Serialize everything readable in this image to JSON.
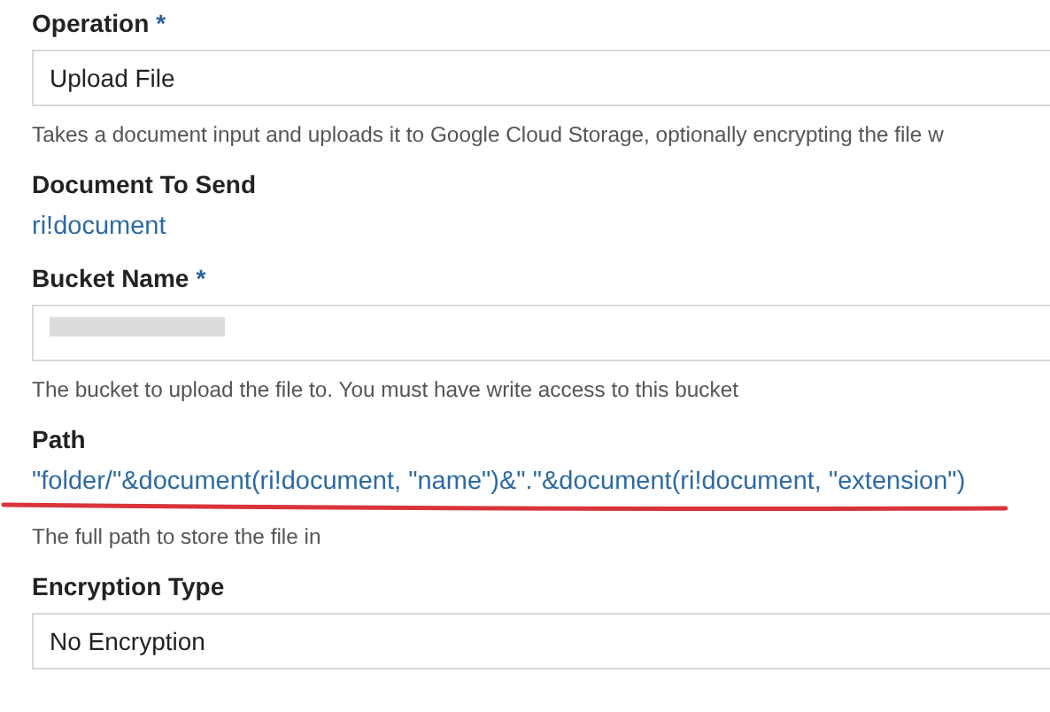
{
  "fields": [
    {
      "label": "Operation",
      "required_mark": "*",
      "kind": "box",
      "value": "Upload File",
      "description": "Takes a document input and uploads it to Google Cloud Storage, optionally encrypting the file w"
    },
    {
      "label": "Document To Send",
      "kind": "expression",
      "value": "ri!document"
    },
    {
      "label": "Bucket Name",
      "required_mark": "*",
      "kind": "box",
      "redacted": true,
      "description": "The bucket to upload the file to. You must have write access to this bucket"
    },
    {
      "label": "Path",
      "kind": "expression",
      "value": "\"folder/\"&document(ri!document, \"name\")&\".\"&document(ri!document, \"extension\")",
      "underlined": true,
      "description": "The full path to store the file in"
    },
    {
      "label": "Encryption Type",
      "kind": "box",
      "value": "No Encryption"
    }
  ]
}
